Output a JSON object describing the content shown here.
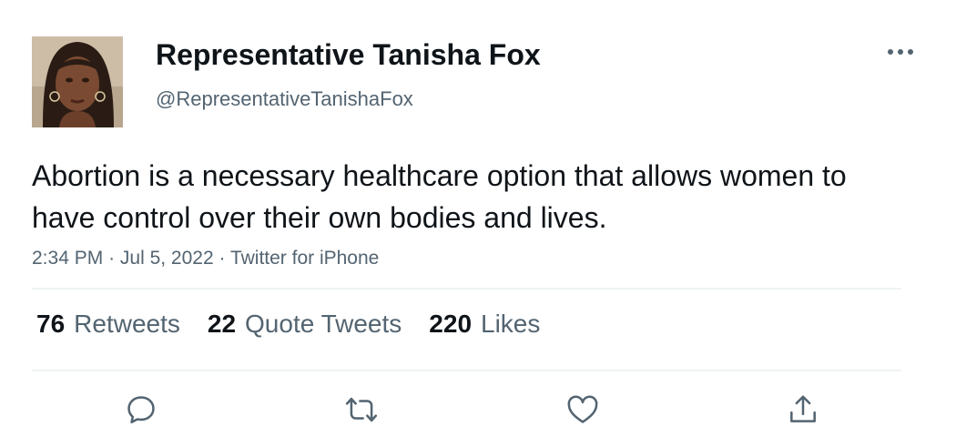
{
  "author": {
    "display_name": "Representative Tanisha Fox",
    "handle": "@RepresentativeTanishaFox",
    "avatar_icon": "profile-photo"
  },
  "tweet": {
    "text": "Abortion is a necessary healthcare option that allows women to have control over their own bodies and lives.",
    "time": "2:34 PM",
    "separator": "·",
    "date": "Jul 5, 2022",
    "source": "Twitter for iPhone"
  },
  "stats": {
    "retweets": {
      "count": "76",
      "label": "Retweets"
    },
    "quote_tweets": {
      "count": "22",
      "label": "Quote Tweets"
    },
    "likes": {
      "count": "220",
      "label": "Likes"
    }
  },
  "actions": [
    "reply-icon",
    "retweet-icon",
    "like-icon",
    "share-icon"
  ],
  "colors": {
    "text_primary": "#0f1419",
    "text_secondary": "#536471",
    "divider": "#eff3f4"
  }
}
